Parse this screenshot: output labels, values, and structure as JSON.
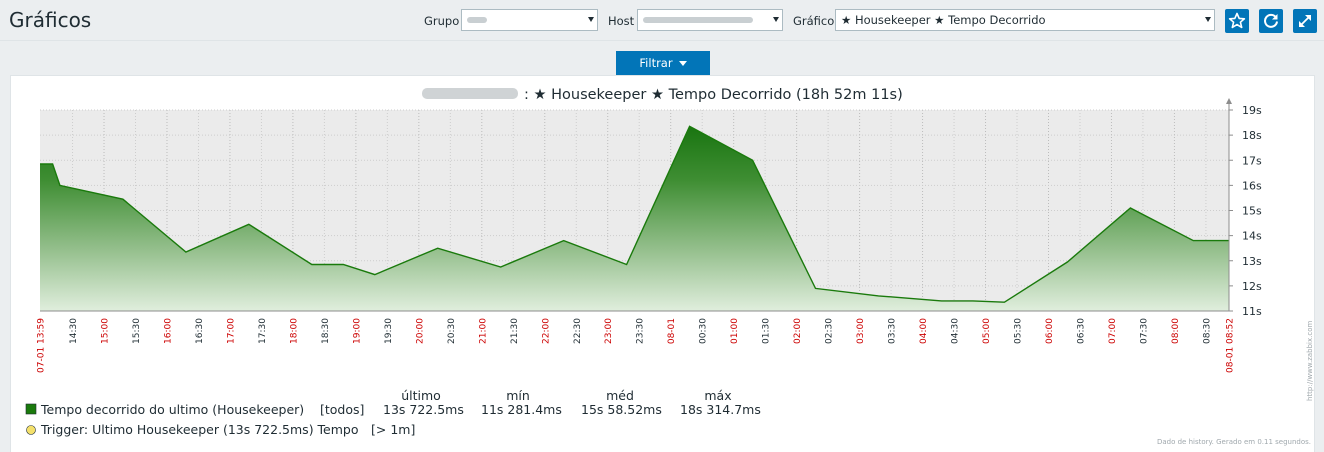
{
  "page": {
    "title": "Gráficos"
  },
  "filter": {
    "group_label": "Grupo",
    "group_value": "",
    "host_label": "Host",
    "host_value": "",
    "graph_label": "Gráfico",
    "graph_value": "★ Housekeeper ★ Tempo Decorrido",
    "filter_tab": "Filtrar"
  },
  "chart_data": {
    "type": "area",
    "title": ": ★ Housekeeper ★ Tempo Decorrido (18h 52m 11s)",
    "y_ticks": [
      "11s",
      "12s",
      "13s",
      "14s",
      "15s",
      "16s",
      "17s",
      "18s",
      "19s"
    ],
    "ylim": [
      11,
      19
    ],
    "x_ticks": [
      {
        "label": "07-01 13:59",
        "red": true
      },
      {
        "label": "14:30",
        "red": false
      },
      {
        "label": "15:00",
        "red": true
      },
      {
        "label": "15:30",
        "red": false
      },
      {
        "label": "16:00",
        "red": true
      },
      {
        "label": "16:30",
        "red": false
      },
      {
        "label": "17:00",
        "red": true
      },
      {
        "label": "17:30",
        "red": false
      },
      {
        "label": "18:00",
        "red": true
      },
      {
        "label": "18:30",
        "red": false
      },
      {
        "label": "19:00",
        "red": true
      },
      {
        "label": "19:30",
        "red": false
      },
      {
        "label": "20:00",
        "red": true
      },
      {
        "label": "20:30",
        "red": false
      },
      {
        "label": "21:00",
        "red": true
      },
      {
        "label": "21:30",
        "red": false
      },
      {
        "label": "22:00",
        "red": true
      },
      {
        "label": "22:30",
        "red": false
      },
      {
        "label": "23:00",
        "red": true
      },
      {
        "label": "23:30",
        "red": false
      },
      {
        "label": "08-01",
        "red": true
      },
      {
        "label": "00:30",
        "red": false
      },
      {
        "label": "01:00",
        "red": true
      },
      {
        "label": "01:30",
        "red": false
      },
      {
        "label": "02:00",
        "red": true
      },
      {
        "label": "02:30",
        "red": false
      },
      {
        "label": "03:00",
        "red": true
      },
      {
        "label": "03:30",
        "red": false
      },
      {
        "label": "04:00",
        "red": true
      },
      {
        "label": "04:30",
        "red": false
      },
      {
        "label": "05:00",
        "red": true
      },
      {
        "label": "05:30",
        "red": false
      },
      {
        "label": "06:00",
        "red": true
      },
      {
        "label": "06:30",
        "red": false
      },
      {
        "label": "07:00",
        "red": true
      },
      {
        "label": "07:30",
        "red": false
      },
      {
        "label": "08:00",
        "red": true
      },
      {
        "label": "08:30",
        "red": false
      },
      {
        "label": "08-01 08:52",
        "red": true
      }
    ],
    "series": [
      {
        "name": "Tempo decorrido do ultimo (Housekeeper)",
        "color": "#1a7a0c",
        "points": [
          [
            "13:59",
            16.85
          ],
          [
            "14:11",
            16.85
          ],
          [
            "14:18",
            16.0
          ],
          [
            "15:18",
            15.45
          ],
          [
            "16:18",
            13.35
          ],
          [
            "17:18",
            14.45
          ],
          [
            "18:18",
            12.85
          ],
          [
            "18:48",
            12.85
          ],
          [
            "19:18",
            12.45
          ],
          [
            "20:18",
            13.5
          ],
          [
            "21:18",
            12.75
          ],
          [
            "22:18",
            13.8
          ],
          [
            "23:18",
            12.85
          ],
          [
            "00:18",
            18.35
          ],
          [
            "01:18",
            17.0
          ],
          [
            "02:18",
            11.9
          ],
          [
            "03:18",
            11.6
          ],
          [
            "04:18",
            11.4
          ],
          [
            "04:48",
            11.4
          ],
          [
            "05:18",
            11.35
          ],
          [
            "06:18",
            12.95
          ],
          [
            "07:18",
            15.1
          ],
          [
            "08:18",
            13.8
          ],
          [
            "08:52",
            13.8
          ]
        ]
      }
    ],
    "legend": {
      "headers": [
        "último",
        "mín",
        "méd",
        "máx"
      ],
      "rows": [
        {
          "kind": "series",
          "color": "#1a7a0c",
          "label": "Tempo decorrido do ultimo (Housekeeper)",
          "func": "[todos]",
          "last": "13s 722.5ms",
          "min": "11s 281.4ms",
          "avg": "15s 58.52ms",
          "max": "18s 314.7ms"
        },
        {
          "kind": "trigger",
          "color": "#f4e06b",
          "label": "Trigger: Ultimo Housekeeper (13s 722.5ms) Tempo",
          "cond": "[> 1m]"
        }
      ]
    },
    "footer": "Dado de history. Gerado em 0.11 segundos.",
    "watermark": "http://www.zabbix.com"
  }
}
